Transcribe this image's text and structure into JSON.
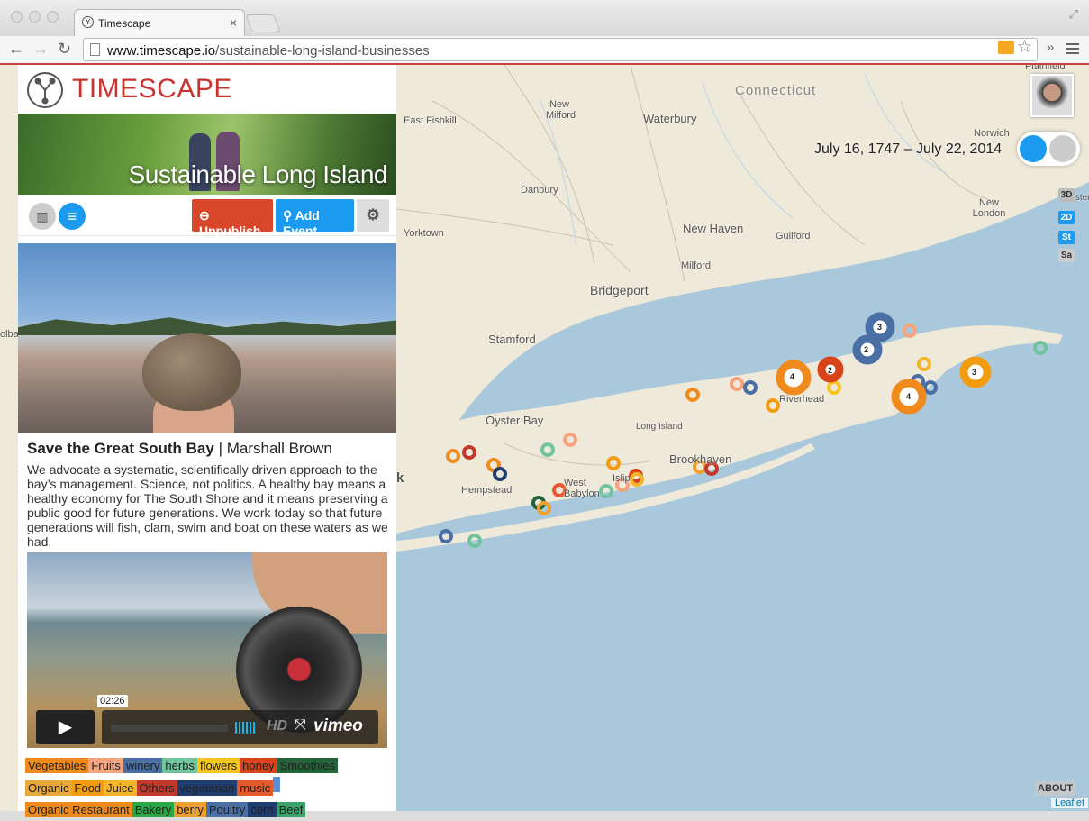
{
  "browser": {
    "tab_title": "Timescape",
    "tab_favicon": "Y",
    "tab_close": "×",
    "url_domain": "www.timescape.io",
    "url_path": "/sustainable-long-island-businesses",
    "back_icon": "←",
    "forward_icon": "→",
    "reload_icon": "↻",
    "star_icon": "☆",
    "overflow_icon": "»",
    "resize_icon": "⤢"
  },
  "panel": {
    "logo_text": "TIMESCAPE",
    "banner_title": "Sustainable Long Island",
    "stats_icon": "▥",
    "list_icon": "≡",
    "unpublish_label": "Unpublish",
    "unpublish_icon": "⊖",
    "add_event_label": "Add Event",
    "add_event_icon": "⚲",
    "settings_icon": "⚙"
  },
  "post": {
    "title": "Save the Great South Bay",
    "separator": " | ",
    "author": "Marshall Brown",
    "body": "We advocate a systematic, scientifically driven approach to the bay’s management. Science, not politics. A healthy bay means a healthy economy for The South Shore and it means preserving a public good for future generations. We work today so that future generations will fish, clam, swim and boat on these waters as we had."
  },
  "video": {
    "play_icon": "▶",
    "time": "02:26",
    "hd": "HD",
    "fullscreen_icon": "⤧",
    "brand": "vimeo"
  },
  "tags": [
    {
      "label": "Vegetables",
      "color": "#f08a1c"
    },
    {
      "label": "Fruits",
      "color": "#f6a47c"
    },
    {
      "label": "winery",
      "color": "#4a6fa5"
    },
    {
      "label": "herbs",
      "color": "#6fc39d"
    },
    {
      "label": "flowers",
      "color": "#f7c51d"
    },
    {
      "label": "honey",
      "color": "#d8431a"
    },
    {
      "label": "Smoothies",
      "color": "#23643a"
    },
    {
      "label": "Organic",
      "color": "#e9a83a"
    },
    {
      "label": "Food",
      "color": "#f39c12"
    },
    {
      "label": "Juice",
      "color": "#f5b42a"
    },
    {
      "label": "Others",
      "color": "#c0392b"
    },
    {
      "label": "vegetarian",
      "color": "#1f3d6e"
    },
    {
      "label": "music",
      "color": "#e55a2b"
    },
    {
      "label": "Organic Restaurant",
      "color": "#f08a1c"
    },
    {
      "label": "Bakery",
      "color": "#27a844"
    },
    {
      "label": "berry",
      "color": "#f0a02c"
    },
    {
      "label": "Poultry",
      "color": "#4a6fa5"
    },
    {
      "label": "corn",
      "color": "#1f3d6e"
    },
    {
      "label": "Beef",
      "color": "#3aa36b"
    }
  ],
  "map": {
    "date_range": "July 16, 1747 – July 22, 2014",
    "modes": [
      "3D",
      "2D",
      "St",
      "Sa"
    ],
    "about": "ABOUT",
    "attribution": "Leaflet",
    "labels": {
      "connecticut": "Connecticut",
      "plainfield": "Plainfield",
      "new_milford": "New Milford",
      "waterbury": "Waterbury",
      "east_fishkill": "East Fishkill",
      "norwich": "Norwich",
      "wester": "Wester",
      "danbury": "Danbury",
      "new_london": "New London",
      "yorktown": "Yorktown",
      "new_haven": "New Haven",
      "guilford": "Guilford",
      "milford": "Milford",
      "bridgeport": "Bridgeport",
      "stamford": "Stamford",
      "riverhead": "Riverhead",
      "oyster_bay": "Oyster Bay",
      "long_island": "Long Island",
      "brookhaven": "Brookhaven",
      "hempstead": "Hempstead",
      "west_babylon": "West Babylon",
      "islip": "Islip",
      "k": "k",
      "olba": "olba"
    },
    "clusters": [
      "3",
      "2",
      "4",
      "2",
      "4",
      "3"
    ]
  }
}
